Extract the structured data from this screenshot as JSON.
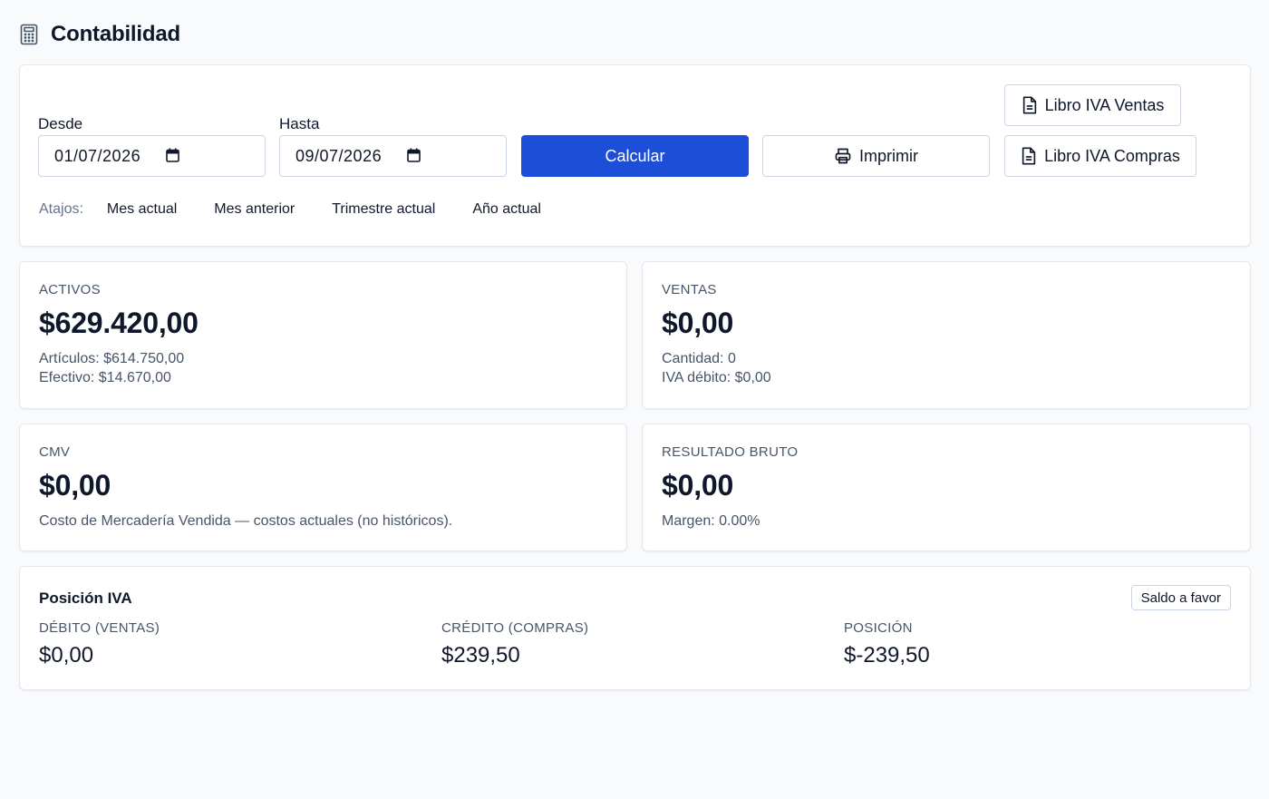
{
  "header": {
    "title": "Contabilidad",
    "icon": "calculator-icon"
  },
  "filters": {
    "from_label": "Desde",
    "from_value": "01/07/2026",
    "to_label": "Hasta",
    "to_value": "09/07/2026",
    "calculate_label": "Calcular",
    "print_label": "Imprimir",
    "sales_book_label": "Libro IVA Ventas",
    "purchases_book_label": "Libro IVA Compras",
    "shortcuts_label": "Atajos:",
    "shortcuts": [
      "Mes actual",
      "Mes anterior",
      "Trimestre actual",
      "Año actual"
    ]
  },
  "activos": {
    "title": "ACTIVOS",
    "value": "$629.420,00",
    "line1": "Artículos: $614.750,00",
    "line2": "Efectivo: $14.670,00"
  },
  "ventas": {
    "title": "VENTAS",
    "value": "$0,00",
    "line1": "Cantidad: 0",
    "line2": "IVA débito: $0,00"
  },
  "cmv": {
    "title": "CMV",
    "value": "$0,00",
    "line1": "Costo de Mercadería Vendida — costos actuales (no históricos)."
  },
  "resultado": {
    "title": "RESULTADO BRUTO",
    "value": "$0,00",
    "line1": "Margen: 0.00%"
  },
  "iva": {
    "title": "Posición IVA",
    "badge": "Saldo a favor",
    "debito_label": "DÉBITO (VENTAS)",
    "debito_value": "$0,00",
    "credito_label": "CRÉDITO (COMPRAS)",
    "credito_value": "$239,50",
    "posicion_label": "POSICIÓN",
    "posicion_value": "$-239,50"
  },
  "colors": {
    "primary": "#1d4ed8",
    "background": "#f8fafc",
    "border": "#e2e8f0",
    "muted_text": "#475569"
  }
}
